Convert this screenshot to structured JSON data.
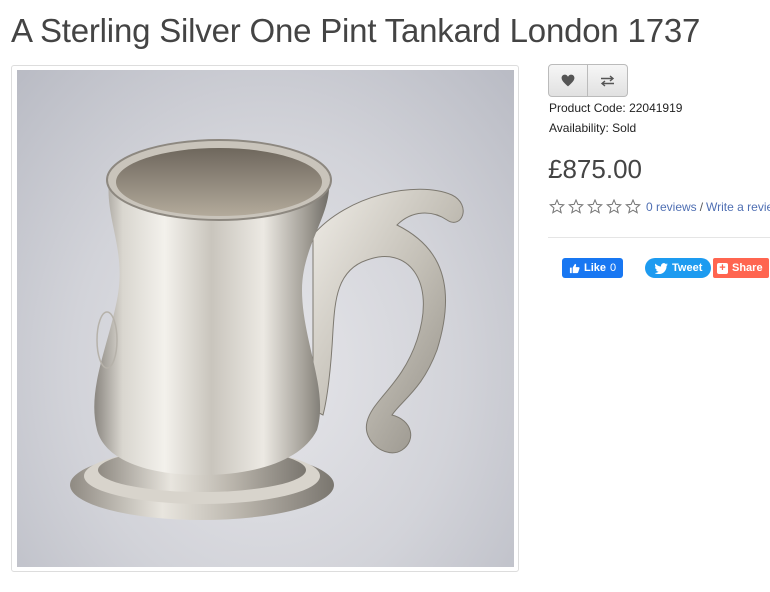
{
  "product": {
    "title": "A Sterling Silver One Pint Tankard London 1737",
    "code_label": "Product Code:",
    "code": "22041919",
    "availability_label": "Availability:",
    "availability": "Sold",
    "price": "£875.00"
  },
  "actions": {
    "wishlist_icon": "heart-icon",
    "compare_icon": "exchange-icon"
  },
  "reviews": {
    "rating": 0,
    "max_rating": 5,
    "count_label": "0 reviews",
    "separator": "/",
    "write_label": "Write a review"
  },
  "social": {
    "facebook_label": "Like",
    "facebook_count": "0",
    "tweet_label": "Tweet",
    "share_label": "Share"
  },
  "colors": {
    "facebook": "#1877f2",
    "twitter": "#1d9bf0",
    "share": "#ff6550",
    "link": "#4f6fb3"
  }
}
